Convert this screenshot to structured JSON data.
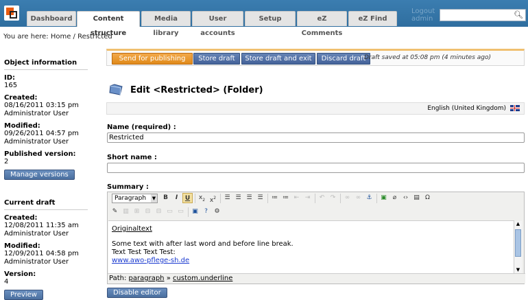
{
  "topnav": {
    "tabs": [
      {
        "label": "Dashboard",
        "active": false
      },
      {
        "label": "Content structure",
        "active": true
      },
      {
        "label": "Media library",
        "active": false
      },
      {
        "label": "User accounts",
        "active": false
      },
      {
        "label": "Setup",
        "active": false
      },
      {
        "label": "eZ Comments",
        "active": false
      },
      {
        "label": "eZ Find",
        "active": false
      }
    ],
    "logout": "Logout",
    "user": "admin"
  },
  "breadcrumb": "You are here: Home / Restricted",
  "sidebar": {
    "object_info_title": "Object information",
    "id_label": "ID:",
    "id_value": "165",
    "created_label": "Created:",
    "created_date": "08/16/2011 03:15 pm",
    "created_by": "Administrator User",
    "modified_label": "Modified:",
    "modified_date": "09/26/2011 04:57 pm",
    "modified_by": "Administrator User",
    "published_label": "Published version:",
    "published_value": "2",
    "manage_versions": "Manage versions",
    "current_draft_title": "Current draft",
    "draft_created_label": "Created:",
    "draft_created_date": "12/08/2011 11:35 am",
    "draft_created_by": "Administrator User",
    "draft_modified_label": "Modified:",
    "draft_modified_date": "12/09/2011 04:58 pm",
    "draft_modified_by": "Administrator User",
    "version_label": "Version:",
    "version_value": "4",
    "preview": "Preview"
  },
  "actions": {
    "send": "Send for publishing",
    "store": "Store draft",
    "store_exit": "Store draft and exit",
    "discard": "Discard draft",
    "status": "Draft saved at 05:08 pm (4 minutes ago)"
  },
  "page": {
    "title": "Edit <Restricted> (Folder)",
    "language": "English (United Kingdom)"
  },
  "fields": {
    "name_label": "Name (required) :",
    "name_value": "Restricted",
    "short_name_label": "Short name :",
    "short_name_value": "",
    "summary_label": "Summary :"
  },
  "editor": {
    "format_select": "Paragraph",
    "content_line1": "Originaltext",
    "content_line2": "Some text with after last  word and before line break.",
    "content_line3": "Text Test Text Test:",
    "content_link": "www.awo-pflege-sh.de",
    "path_label": "Path:",
    "path_1": "paragraph",
    "path_sep": "»",
    "path_2": "custom.underline",
    "disable_button": "Disable editor"
  },
  "colors": {
    "topbar": "#3b7db0",
    "primary_button": "#e08a1a",
    "secondary_button": "#45639a"
  }
}
